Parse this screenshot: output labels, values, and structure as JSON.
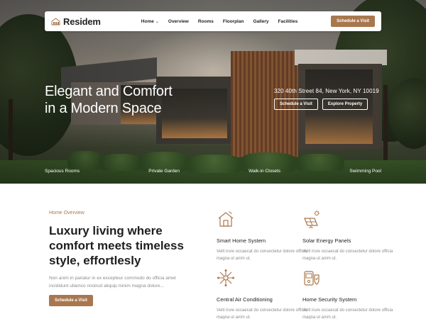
{
  "brand": {
    "name": "Residem",
    "accent": "#a8774e"
  },
  "nav": {
    "links": [
      "Home",
      "Overview",
      "Rooms",
      "Floorplan",
      "Gallery",
      "Facilities"
    ],
    "cta": "Schedule a Visit"
  },
  "hero": {
    "title_line1": "Elegant and Comfort",
    "title_line2": "in a Modern Space",
    "address": "320 40th Street 84, New York, NY 10019",
    "btn_visit": "Schedule a Visit",
    "btn_explore": "Explore Property",
    "features": [
      "Spacious Rooms",
      "Private Garden",
      "Walk-in Closets",
      "Swimming Pool"
    ]
  },
  "overview": {
    "eyebrow": "Home Overview",
    "heading_line1": "Luxury living where",
    "heading_line2": "comfort meets timeless",
    "heading_line3": "style, effortlesly",
    "body": "Non anim in pariatur in ex excepteur commodo do officia amet incididunt ullamco nostrud aliquip minim magna dolore...",
    "cta": "Schedule a Visit",
    "features": [
      {
        "icon": "smart-home-icon",
        "title": "Smart Home System",
        "desc": "Velit irure occaecat do consectetur dolore officia magna ut anim ut."
      },
      {
        "icon": "solar-panel-icon",
        "title": "Solar Energy Panels",
        "desc": "Velit irure occaecat do consectetur dolore officia magna ut anim ut."
      },
      {
        "icon": "air-conditioning-icon",
        "title": "Central Air Conditioning",
        "desc": "Velit irure occaecat do consectetur dolore officia magna ut anim ut."
      },
      {
        "icon": "security-system-icon",
        "title": "Home Security System",
        "desc": "Velit irure occaecat do consectetur dolore officia magna ut anim ut."
      }
    ]
  }
}
